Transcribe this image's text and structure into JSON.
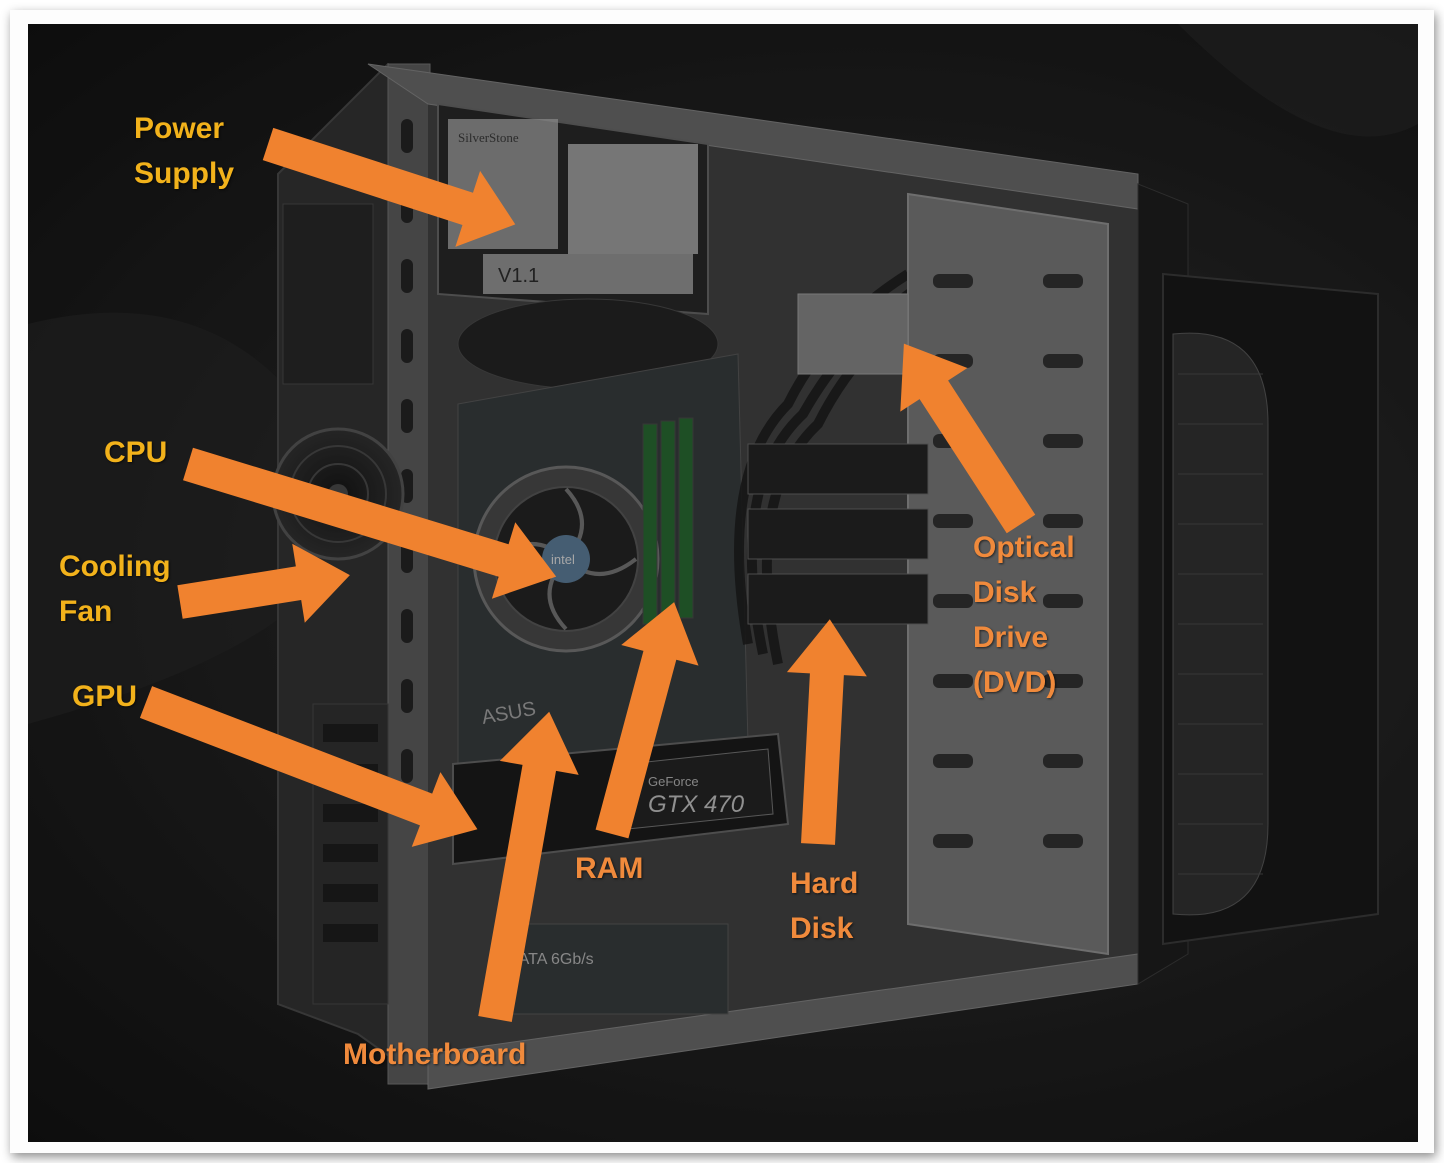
{
  "figure": {
    "labels": {
      "power_supply": "Power\nSupply",
      "cpu": "CPU",
      "cooling_fan": "Cooling\nFan",
      "gpu": "GPU",
      "motherboard": "Motherboard",
      "ram": "RAM",
      "hard_disk": "Hard\nDisk",
      "optical_drive": "Optical\nDisk\nDrive\n(DVD)"
    },
    "component_text": {
      "gpu_brand": "GeForce",
      "gpu_model": "GTX 470",
      "psu_version": "V1.1",
      "sata_text": "SATA 6Gb/s",
      "board_brand": "ASUS",
      "cpu_brand": "intel",
      "psu_brand": "SilverStone"
    },
    "colors": {
      "arrow": "#f0822f",
      "label_yellow": "#f2b21b",
      "label_orange": "#f08a3c"
    },
    "icons": [
      "orange-arrow-icon"
    ]
  }
}
